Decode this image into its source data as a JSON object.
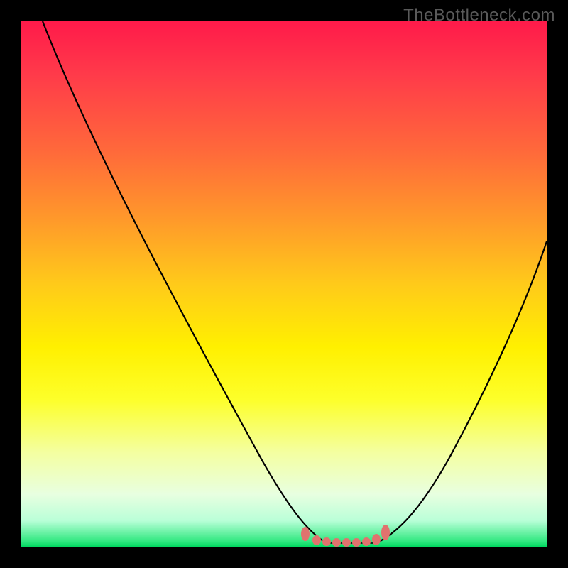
{
  "watermark": "TheBottleneck.com",
  "chart_data": {
    "type": "line",
    "title": "",
    "xlabel": "",
    "ylabel": "",
    "xlim": [
      0,
      100
    ],
    "ylim": [
      0,
      100
    ],
    "series": [
      {
        "name": "left-curve",
        "x": [
          0,
          5,
          10,
          15,
          20,
          25,
          30,
          35,
          40,
          45,
          50,
          52,
          54,
          56,
          58,
          60,
          62,
          64
        ],
        "y": [
          100,
          96,
          91,
          85,
          79,
          72,
          64,
          56,
          47,
          37,
          26,
          21,
          16,
          11,
          7,
          4,
          2,
          0
        ]
      },
      {
        "name": "right-curve",
        "x": [
          66,
          68,
          70,
          73,
          76,
          79,
          82,
          85,
          88,
          91,
          94,
          97,
          100
        ],
        "y": [
          0,
          2,
          4,
          8,
          13,
          19,
          26,
          33,
          40,
          47,
          52,
          56,
          58
        ]
      },
      {
        "name": "bottom-markers",
        "x": [
          53,
          55,
          57,
          59,
          61,
          63,
          65,
          67,
          69
        ],
        "y": [
          2,
          1,
          1,
          1,
          1,
          1,
          1,
          2,
          3
        ]
      }
    ],
    "gradient_stops": [
      {
        "pos": 0.0,
        "color": "#ff1a4a"
      },
      {
        "pos": 0.1,
        "color": "#ff3a4a"
      },
      {
        "pos": 0.25,
        "color": "#ff6a3a"
      },
      {
        "pos": 0.38,
        "color": "#ff9a2a"
      },
      {
        "pos": 0.5,
        "color": "#ffca1a"
      },
      {
        "pos": 0.62,
        "color": "#fff000"
      },
      {
        "pos": 0.72,
        "color": "#fdff2a"
      },
      {
        "pos": 0.82,
        "color": "#f4ffa0"
      },
      {
        "pos": 0.9,
        "color": "#e8ffe0"
      },
      {
        "pos": 0.95,
        "color": "#baffd8"
      },
      {
        "pos": 0.99,
        "color": "#30e880"
      },
      {
        "pos": 1.0,
        "color": "#00d860"
      }
    ],
    "marker_color": "#e0736e",
    "curve_color": "#000000"
  }
}
